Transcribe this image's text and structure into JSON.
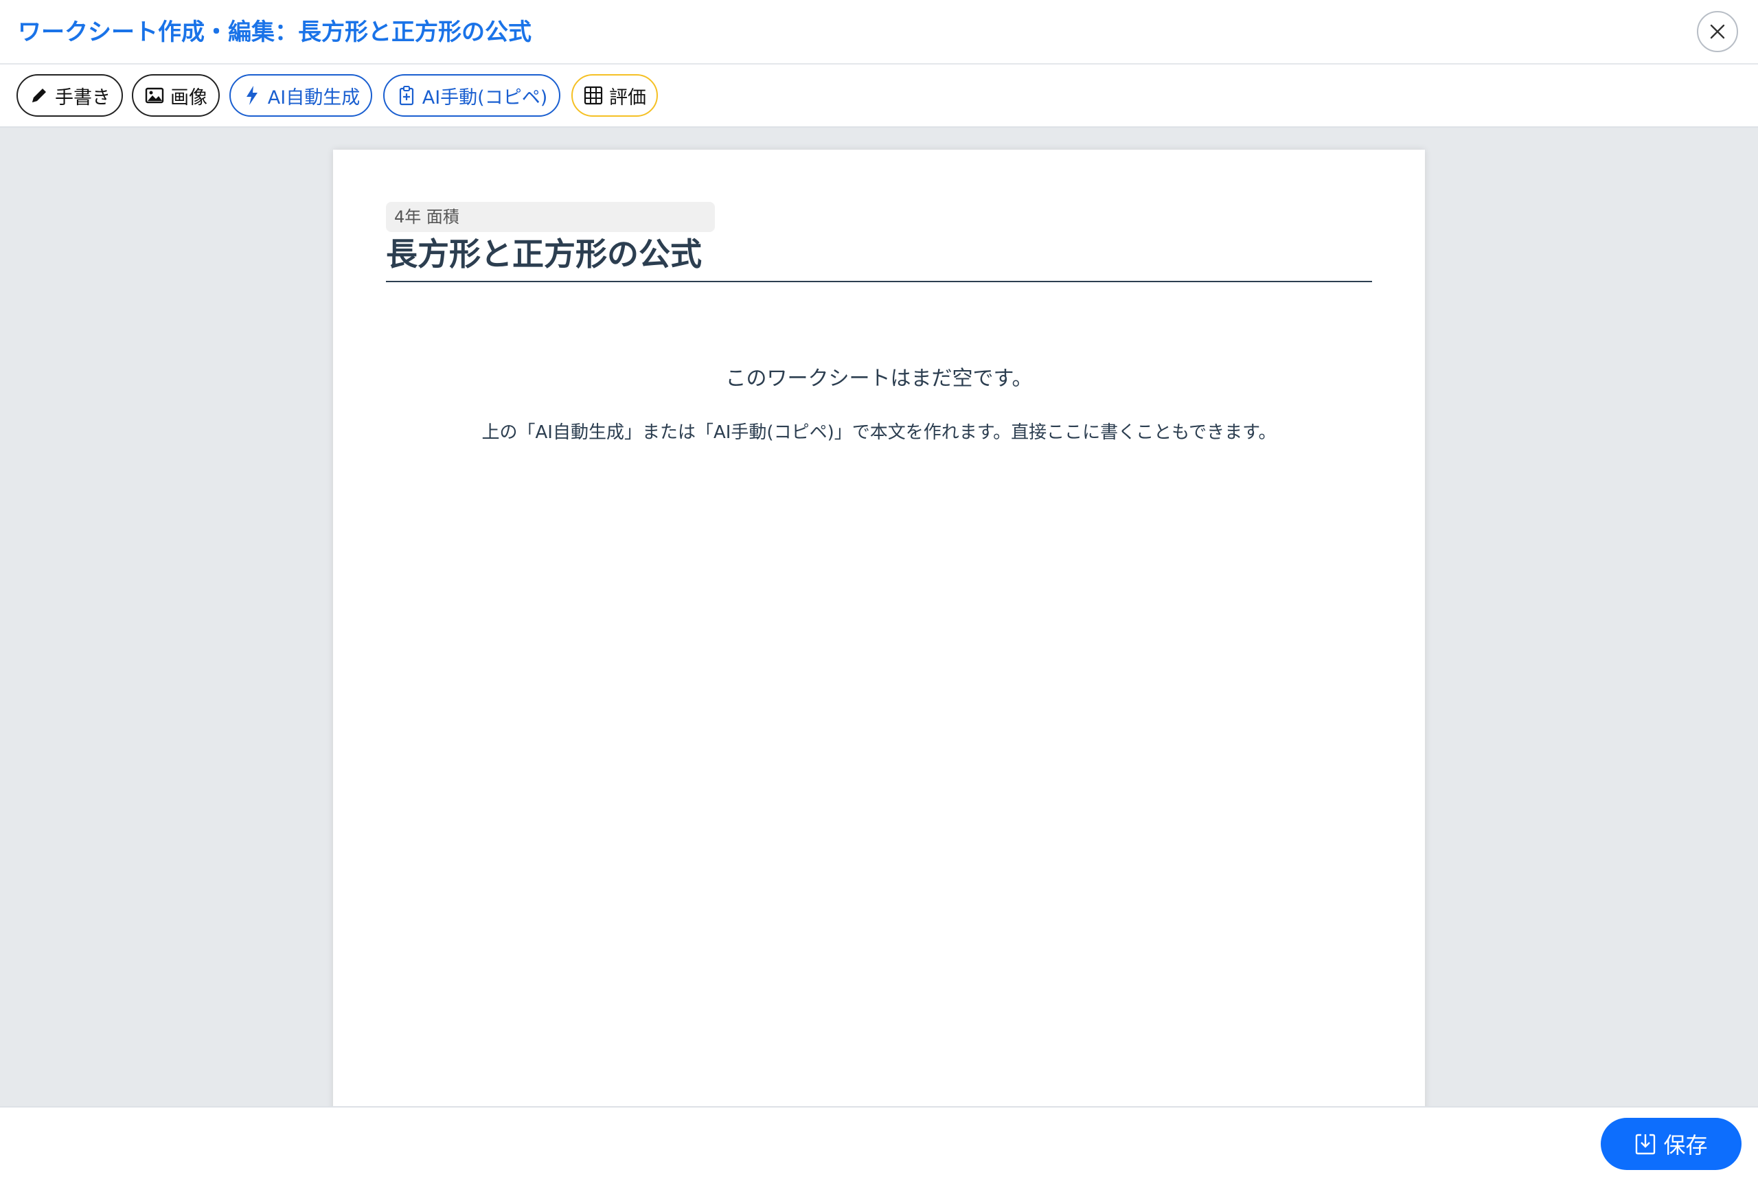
{
  "header": {
    "title": "ワークシート作成・編集：長方形と正方形の公式"
  },
  "toolbar": {
    "buttons": [
      {
        "label": "手書き",
        "icon": "pencil-icon"
      },
      {
        "label": "画像",
        "icon": "image-icon"
      },
      {
        "label": "AI自動生成",
        "icon": "lightning-icon"
      },
      {
        "label": "AI手動(コピペ)",
        "icon": "clipboard-icon"
      },
      {
        "label": "評価",
        "icon": "grid-icon"
      }
    ]
  },
  "sheet": {
    "subject": "4年 面積",
    "title": "長方形と正方形の公式",
    "empty_message": "このワークシートはまだ空です。",
    "empty_hint": "上の「AI自動生成」または「AI手動(コピペ)」で本文を作れます。直接ここに書くこともできます。"
  },
  "footer": {
    "save_label": "保存"
  },
  "colors": {
    "accent": "#1a73e8",
    "primary_button": "#0d6efd",
    "ai_button_border": "#1a5fd0",
    "evaluate_border": "#f5c024",
    "canvas_bg": "#e6e9ec"
  }
}
